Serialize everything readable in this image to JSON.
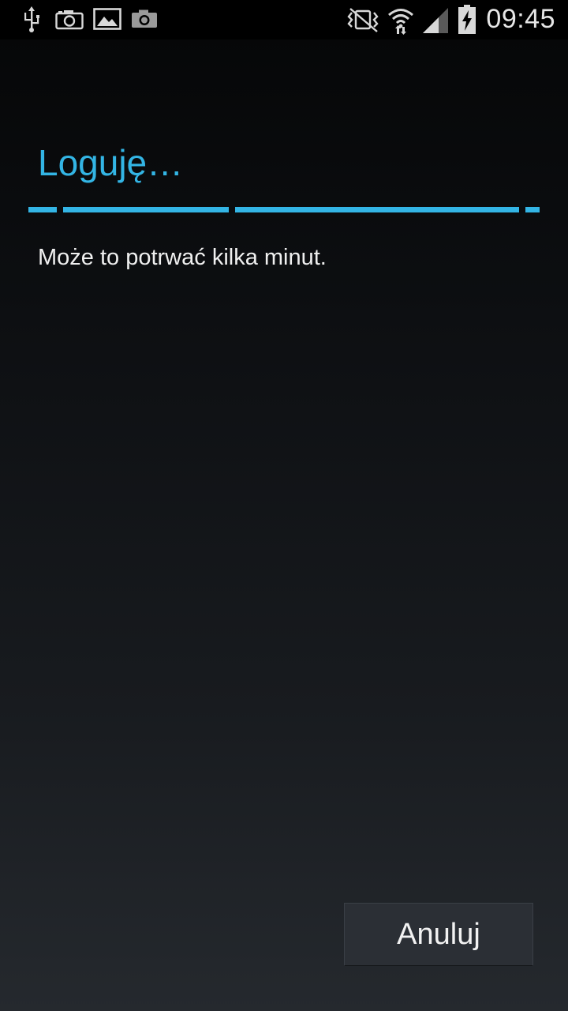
{
  "status_bar": {
    "time": "09:45",
    "icons": [
      "usb-icon",
      "camera-icon",
      "image-icon",
      "camera-icon",
      "vibrate-silent-icon",
      "wifi-icon",
      "signal-icon",
      "battery-charging-icon"
    ]
  },
  "dialog": {
    "title": "Loguję…",
    "message": "Może to potrwać kilka minut.",
    "cancel_label": "Anuluj"
  },
  "colors": {
    "accent": "#33b5e5",
    "background_top": "#050607",
    "background_bottom": "#25292e"
  }
}
